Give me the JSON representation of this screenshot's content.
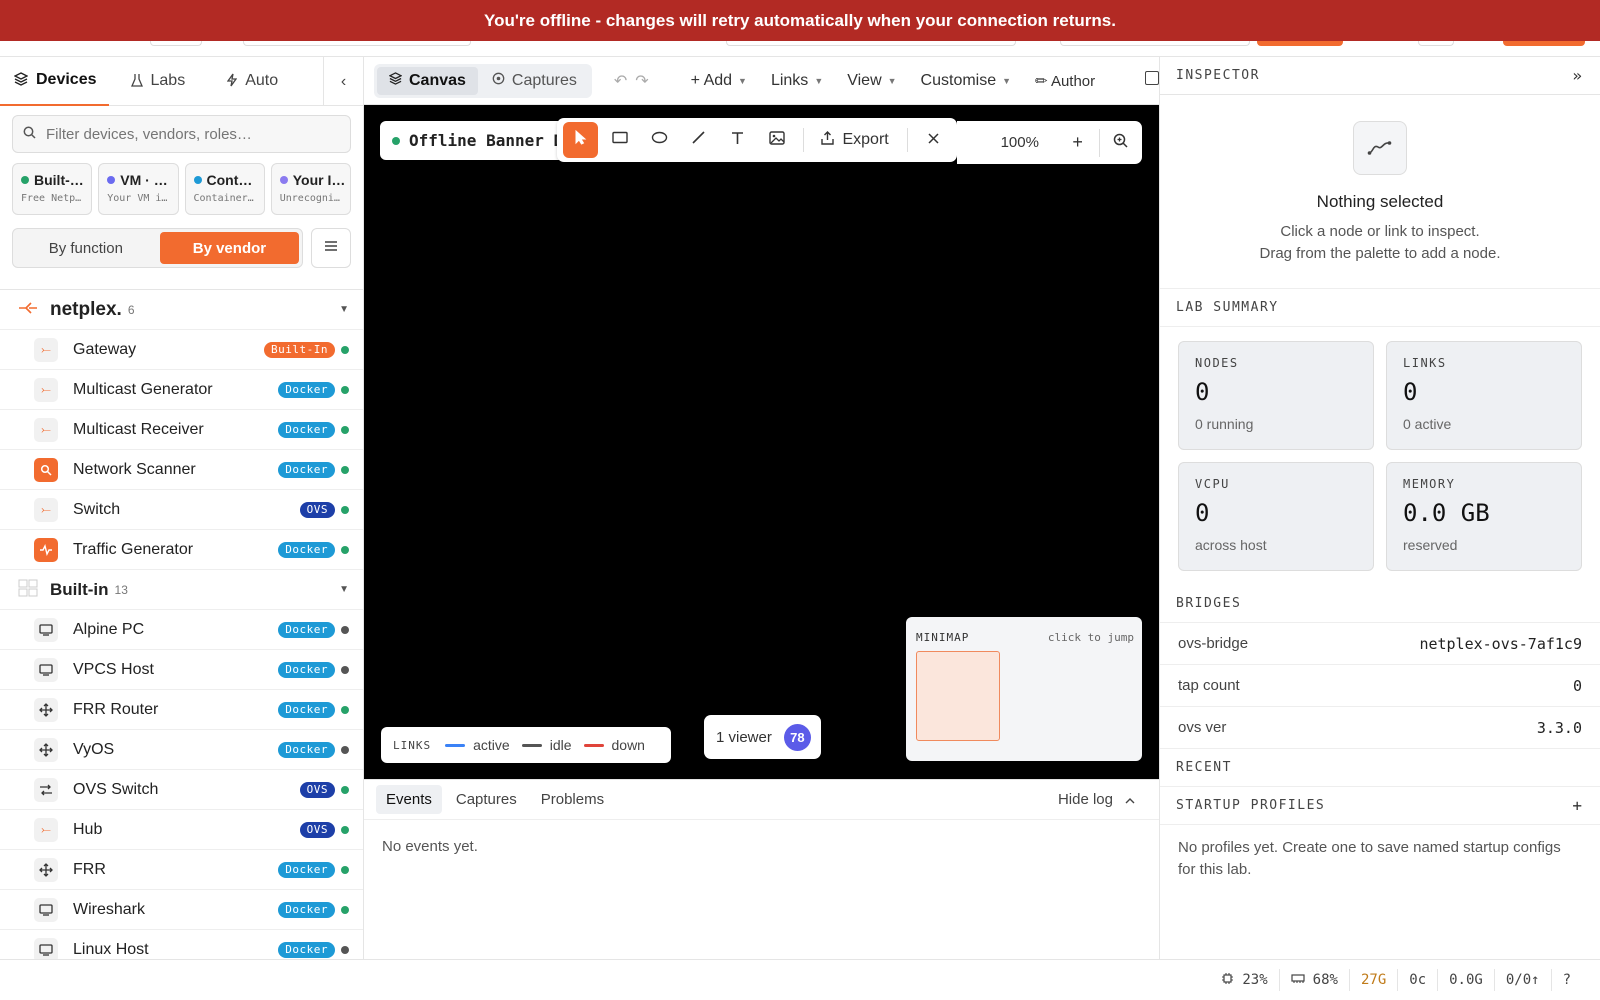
{
  "banner": {
    "text": "You're offline - changes will retry automatically when your connection returns."
  },
  "sidebar": {
    "tabs": [
      {
        "label": "Devices",
        "icon": "layers-icon"
      },
      {
        "label": "Labs",
        "icon": "flask-icon"
      },
      {
        "label": "Auto",
        "icon": "bolt-icon"
      }
    ],
    "collapse_glyph": "‹",
    "filter_placeholder": "Filter devices, vendors, roles…",
    "categories": [
      {
        "title": "Built-…",
        "sub": "Free Netp…",
        "dot": ""
      },
      {
        "title": "VM · …",
        "sub": "Your VM i…",
        "dot": "#6b6bf0"
      },
      {
        "title": "Cont…",
        "sub": "Container…",
        "dot": "#1e9ad6"
      },
      {
        "title": "Your I…",
        "sub": "Unrecogni…",
        "dot": "#8b7bf0"
      }
    ],
    "group_by": {
      "function": "By function",
      "vendor": "By vendor",
      "selected": "By vendor"
    },
    "groups": [
      {
        "name": "netplex.",
        "count": "6"
      },
      {
        "name": "Built-in",
        "count": "13"
      }
    ],
    "netplex_devices": [
      {
        "name": "Gateway",
        "badge": "Built-In",
        "status": "green"
      },
      {
        "name": "Multicast Generator",
        "badge": "Docker",
        "status": "green"
      },
      {
        "name": "Multicast Receiver",
        "badge": "Docker",
        "status": "green"
      },
      {
        "name": "Network Scanner",
        "badge": "Docker",
        "status": "green"
      },
      {
        "name": "Switch",
        "badge": "OVS",
        "status": "green"
      },
      {
        "name": "Traffic Generator",
        "badge": "Docker",
        "status": "green"
      }
    ],
    "builtin_devices": [
      {
        "name": "Alpine PC",
        "badge": "Docker",
        "status": "grey"
      },
      {
        "name": "VPCS Host",
        "badge": "Docker",
        "status": "grey"
      },
      {
        "name": "FRR Router",
        "badge": "Docker",
        "status": "green"
      },
      {
        "name": "VyOS",
        "badge": "Docker",
        "status": "grey"
      },
      {
        "name": "OVS Switch",
        "badge": "OVS",
        "status": "green"
      },
      {
        "name": "Hub",
        "badge": "OVS",
        "status": "green"
      },
      {
        "name": "FRR",
        "badge": "Docker",
        "status": "green"
      },
      {
        "name": "Wireshark",
        "badge": "Docker",
        "status": "green"
      },
      {
        "name": "Linux Host",
        "badge": "Docker",
        "status": "grey"
      }
    ]
  },
  "toolbar": {
    "canvas": "Canvas",
    "captures": "Captures",
    "add": "+ Add",
    "links": "Links",
    "view": "View",
    "customise": "Customise",
    "author": "✏ Author"
  },
  "canvas": {
    "lab_name": "Offline Banner De",
    "export": "Export",
    "zoom": "100%",
    "legend": {
      "title": "LINKS",
      "active": "active",
      "idle": "idle",
      "down": "down"
    },
    "viewers": {
      "label": "1 viewer",
      "count": "78"
    },
    "minimap": {
      "title": "MINIMAP",
      "hint": "click to jump"
    }
  },
  "log": {
    "tabs": [
      "Events",
      "Captures",
      "Problems"
    ],
    "hide": "Hide log",
    "empty": "No events yet."
  },
  "inspector": {
    "title": "INSPECTOR",
    "collapse": "»",
    "empty_title": "Nothing selected",
    "empty_line1": "Click a node or link to inspect.",
    "empty_line2": "Drag from the palette to add a node.",
    "summary_title": "LAB SUMMARY",
    "cards": [
      {
        "key": "NODES",
        "value": "0",
        "sub": "0 running"
      },
      {
        "key": "LINKS",
        "value": "0",
        "sub": "0 active"
      },
      {
        "key": "VCPU",
        "value": "0",
        "sub": "across host"
      },
      {
        "key": "MEMORY",
        "value": "0.0 GB",
        "sub": "reserved"
      }
    ],
    "bridges_title": "BRIDGES",
    "bridges": [
      {
        "k": "ovs-bridge",
        "v": "netplex-ovs-7af1c9"
      },
      {
        "k": "tap count",
        "v": "0"
      },
      {
        "k": "ovs ver",
        "v": "3.3.0"
      }
    ],
    "recent_title": "RECENT",
    "profiles_title": "STARTUP PROFILES",
    "profiles_add": "+",
    "profiles_empty": "No profiles yet. Create one to save named startup configs for this lab."
  },
  "status": {
    "cpu": "23%",
    "mem": "68%",
    "disk": "27G",
    "temp": "0c",
    "swap": "0.0G",
    "net": "0/0↑",
    "help": "?"
  },
  "colors": {
    "accent": "#f26b2f",
    "banner": "#b22a24",
    "docker": "#1e9ad6",
    "ovs": "#1d3fa8"
  }
}
